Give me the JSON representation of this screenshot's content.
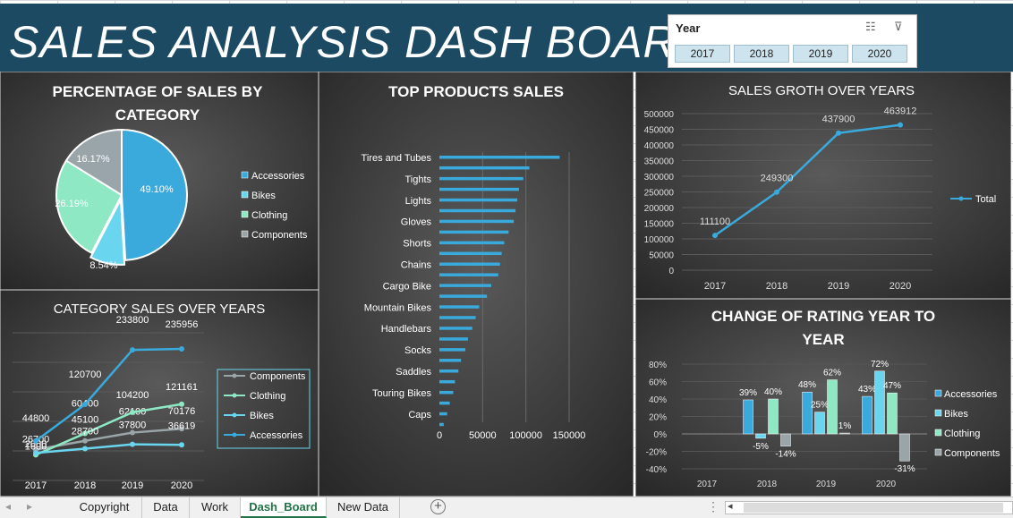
{
  "title": "SALES ANALYSIS DASH BOARD",
  "slicer": {
    "title": "Year",
    "buttons": [
      "2017",
      "2018",
      "2019",
      "2020"
    ]
  },
  "tabs": [
    "Copyright",
    "Data",
    "Work",
    "Dash_Board",
    "New Data"
  ],
  "active_tab": "Dash_Board",
  "colors": {
    "banner": "#1d4a63",
    "panel_bg": "#3f3f3f",
    "blue": "#3aa9dc",
    "light_blue": "#6ad5ee",
    "mint": "#8ee8c4",
    "grey": "#9aa5a9",
    "excel_green": "#217346"
  },
  "icons": {
    "multi_select": "multi-select-icon",
    "clear_filter": "clear-filter-icon",
    "add_sheet": "add-sheet-icon"
  },
  "chart_data": [
    {
      "id": "pie",
      "type": "pie",
      "title": "PERCENTAGE  OF SALES BY CATEGORY",
      "categories": [
        "Accessories",
        "Bikes",
        "Clothing",
        "Components"
      ],
      "values": [
        49.1,
        8.54,
        26.19,
        16.17
      ],
      "labels": [
        "49.10%",
        "8.54%",
        "26.19%",
        "16.17%"
      ],
      "legend": "right"
    },
    {
      "id": "category_lines",
      "type": "line",
      "title": "CATEGORY SALES OVER YEARS",
      "categories": [
        "2017",
        "2018",
        "2019",
        "2020"
      ],
      "series": [
        {
          "name": "Components",
          "values": [
            26700,
            45100,
            62100,
            70176
          ],
          "labels": [
            "26700",
            "45100",
            "62100",
            "70176"
          ]
        },
        {
          "name": "Clothing",
          "values": [
            16000,
            60400,
            104200,
            121161
          ],
          "labels": [
            "1600",
            "60400",
            "104200",
            "121161"
          ]
        },
        {
          "name": "Bikes",
          "values": [
            20000,
            28700,
            37800,
            36619
          ],
          "labels": [
            "2000",
            "28700",
            "37800",
            "36619"
          ]
        },
        {
          "name": "Accessories",
          "values": [
            44800,
            120700,
            233800,
            235956
          ],
          "labels": [
            "44800",
            "120700",
            "233800",
            "235956"
          ]
        }
      ],
      "xlabels": [
        "2017",
        "2018",
        "2019",
        "2020"
      ],
      "legend": "right"
    },
    {
      "id": "top_products",
      "type": "bar",
      "title": "TOP PRODUCTS SALES",
      "categories": [
        "Tires and Tubes",
        "",
        "Tights",
        "",
        "Lights",
        "",
        "Gloves",
        "",
        "Shorts",
        "",
        "Chains",
        "",
        "Cargo Bike",
        "",
        "Mountain Bikes",
        "",
        "Handlebars",
        "",
        "Socks",
        "",
        "Saddles",
        "",
        "Touring Bikes",
        "",
        "Caps"
      ],
      "values": [
        139000,
        104000,
        97000,
        92000,
        90000,
        88000,
        86000,
        80000,
        75000,
        72000,
        70000,
        68000,
        60000,
        55000,
        46000,
        42000,
        38000,
        33000,
        30000,
        25000,
        22000,
        18000,
        16000,
        12000,
        9000,
        5000
      ],
      "xticks": [
        "0",
        "50000",
        "100000",
        "150000"
      ],
      "xlim": [
        0,
        150000
      ]
    },
    {
      "id": "sales_growth",
      "type": "line",
      "title": "SALES GROTH OVER YEARS",
      "categories": [
        "2017",
        "2018",
        "2019",
        "2020"
      ],
      "series": [
        {
          "name": "Total",
          "values": [
            111100,
            249300,
            437900,
            463912
          ],
          "labels": [
            "111100",
            "249300",
            "437900",
            "463912"
          ]
        }
      ],
      "yticks": [
        "500000",
        "450000",
        "400000",
        "350000",
        "300000",
        "250000",
        "200000",
        "150000",
        "100000",
        "50000",
        "0"
      ],
      "ylim": [
        0,
        500000
      ],
      "legend": "right"
    },
    {
      "id": "rating_change",
      "type": "bar",
      "title": "CHANGE  OF RATING YEAR TO YEAR",
      "categories": [
        "2017",
        "2018",
        "2019",
        "2020"
      ],
      "series": [
        {
          "name": "Accessories",
          "values": [
            null,
            39,
            48,
            43
          ],
          "labels": [
            "",
            "39%",
            "48%",
            "43%"
          ]
        },
        {
          "name": "Bikes",
          "values": [
            null,
            -5,
            25,
            72
          ],
          "labels": [
            "",
            "-5%",
            "25%",
            "72%"
          ]
        },
        {
          "name": "Clothing",
          "values": [
            null,
            40,
            62,
            47
          ],
          "labels": [
            "",
            "40%",
            "62%",
            "47%"
          ]
        },
        {
          "name": "Components",
          "values": [
            null,
            -14,
            1,
            -31
          ],
          "labels": [
            "",
            "-14%",
            "1%",
            "-31%"
          ]
        }
      ],
      "yticks": [
        "80%",
        "60%",
        "40%",
        "20%",
        "0%",
        "-20%",
        "-40%"
      ],
      "ylim": [
        -40,
        80
      ],
      "legend": "right"
    }
  ]
}
